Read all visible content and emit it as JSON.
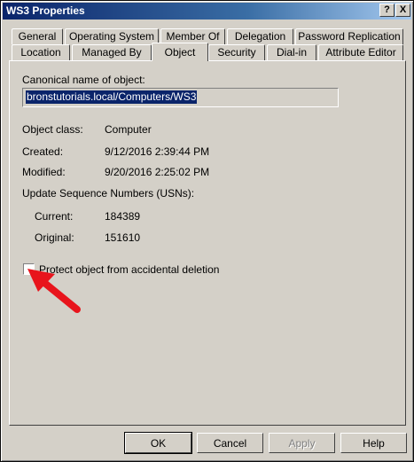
{
  "window": {
    "title": "WS3 Properties"
  },
  "titlebar_buttons": {
    "help": "?",
    "close": "X"
  },
  "tabs_row1": [
    "General",
    "Operating System",
    "Member Of",
    "Delegation",
    "Password Replication"
  ],
  "tabs_row2": [
    "Location",
    "Managed By",
    "Object",
    "Security",
    "Dial-in",
    "Attribute Editor"
  ],
  "active_tab": "Object",
  "object": {
    "canonical_label": "Canonical name of object:",
    "canonical_value": "bronstutorials.local/Computers/WS3",
    "class_label": "Object class:",
    "class_value": "Computer",
    "created_label": "Created:",
    "created_value": "9/12/2016 2:39:44 PM",
    "modified_label": "Modified:",
    "modified_value": "9/20/2016 2:25:02 PM",
    "usn_label": "Update Sequence Numbers (USNs):",
    "current_label": "Current:",
    "current_value": "184389",
    "original_label": "Original:",
    "original_value": "151610",
    "protect_label": "Protect object from accidental deletion",
    "protect_checked": false
  },
  "buttons": {
    "ok": "OK",
    "cancel": "Cancel",
    "apply": "Apply",
    "help": "Help"
  },
  "colors": {
    "titlebar": "#0a246a",
    "face": "#d4d0c8",
    "arrow": "#e8141c"
  }
}
